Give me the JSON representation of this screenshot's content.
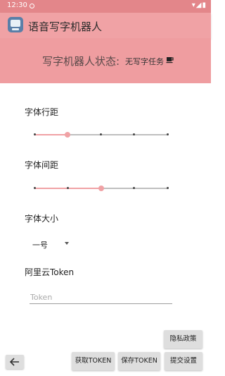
{
  "status_bar": {
    "time": "12:30"
  },
  "app": {
    "title": "语音写字机器人"
  },
  "robot_status": {
    "label": "写字机器人状态:",
    "value": "无写字任务",
    "icon": "coffee-cup-icon"
  },
  "line_spacing": {
    "label": "字体行距",
    "steps": 5,
    "selected_index": 1
  },
  "letter_spacing": {
    "label": "字体间距",
    "steps": 5,
    "selected_index": 2
  },
  "font_size": {
    "label": "字体大小",
    "selected": "一号"
  },
  "aliyun_token": {
    "label": "阿里云Token",
    "value": "",
    "placeholder": "Token"
  },
  "buttons": {
    "privacy": "隐私政策",
    "get_token": "获取TOKEN",
    "save_token": "保存TOKEN",
    "submit": "提交设置"
  },
  "colors": {
    "accent": "#f0a2a5",
    "status_bar": "#e3868a",
    "panel": "#ef9da0"
  }
}
